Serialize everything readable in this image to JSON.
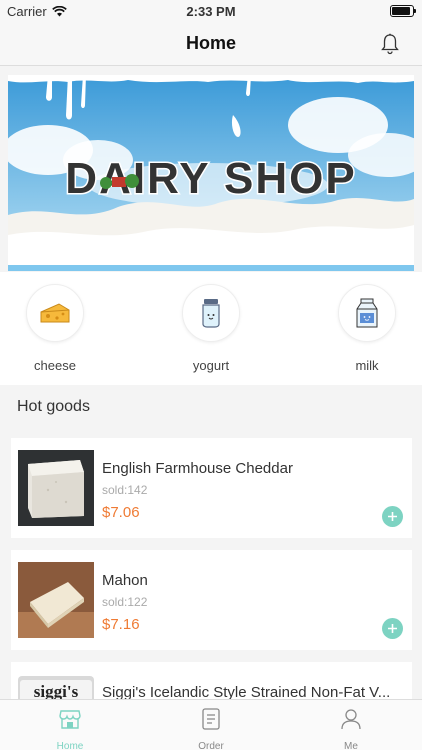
{
  "status_bar": {
    "carrier": "Carrier",
    "time": "2:33 PM",
    "battery_level": 0.9
  },
  "nav": {
    "title": "Home",
    "bell_icon": "bell-icon"
  },
  "banner": {
    "text": "DAIRY SHOP",
    "image": "milk-splash-banner"
  },
  "categories": [
    {
      "label": "cheese",
      "icon": "cheese-icon"
    },
    {
      "label": "yogurt",
      "icon": "yogurt-jar-icon"
    },
    {
      "label": "milk",
      "icon": "milk-carton-icon"
    }
  ],
  "hot_goods": {
    "title": "Hot goods",
    "items": [
      {
        "name": "English Farmhouse Cheddar",
        "sold": "sold:142",
        "price": "$7.06"
      },
      {
        "name": "Mahon",
        "sold": "sold:122",
        "price": "$7.16"
      },
      {
        "name": "Siggi's Icelandic Style Strained Non-Fat V...",
        "sold": "",
        "price": "",
        "brand_label": "siggi's"
      }
    ]
  },
  "tab_bar": {
    "tabs": [
      {
        "label": "Home",
        "icon": "shop-icon",
        "active": true
      },
      {
        "label": "Order",
        "icon": "document-icon",
        "active": false
      },
      {
        "label": "Me",
        "icon": "person-icon",
        "active": false
      }
    ]
  },
  "colors": {
    "accent": "#7dd3c2",
    "price": "#ef7b34"
  }
}
